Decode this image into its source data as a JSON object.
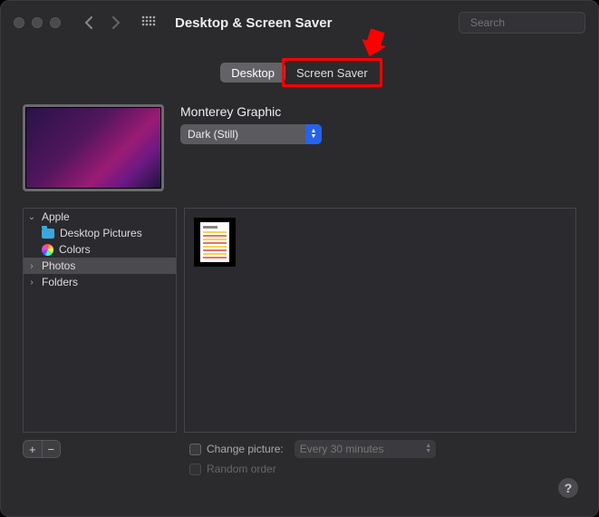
{
  "titlebar": {
    "title": "Desktop & Screen Saver",
    "search_placeholder": "Search"
  },
  "tabs": {
    "desktop": "Desktop",
    "screensaver": "Screen Saver"
  },
  "preview": {
    "name": "Monterey Graphic",
    "variant_selected": "Dark (Still)"
  },
  "sidebar": {
    "apple": "Apple",
    "desktop_pictures": "Desktop Pictures",
    "colors": "Colors",
    "photos": "Photos",
    "folders": "Folders"
  },
  "footer": {
    "change_picture": "Change picture:",
    "interval": "Every 30 minutes",
    "random_order": "Random order"
  },
  "help": "?"
}
